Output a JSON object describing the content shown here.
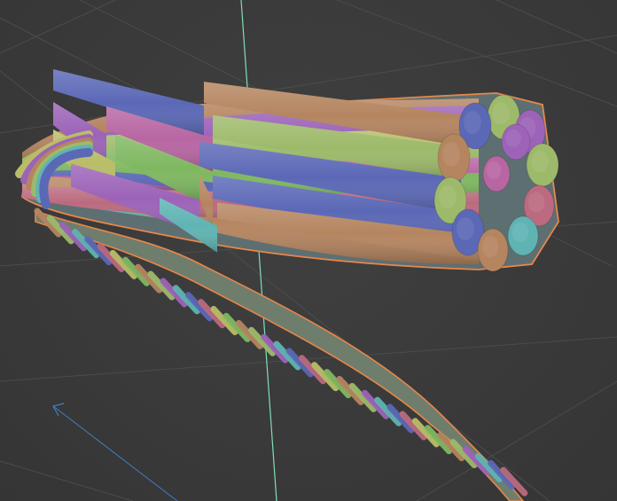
{
  "viewport": {
    "background": "#3a3a3a",
    "grid_color": "#4c4c4c",
    "axis_y_color": "#7fe0b4",
    "axis_x_color": "#3f7fc0",
    "selection_outline_color": "#e8874a"
  },
  "object": {
    "strand_colors": {
      "blue": "#5b68b6",
      "tan": "#b58560",
      "green": "#9dba6a",
      "lime": "#7fb861",
      "purple": "#9c63b8",
      "magenta": "#b866a2",
      "rose": "#bb6a7f",
      "teal": "#5fb4b3",
      "mint": "#63c39a",
      "olive": "#b9bd68"
    }
  }
}
